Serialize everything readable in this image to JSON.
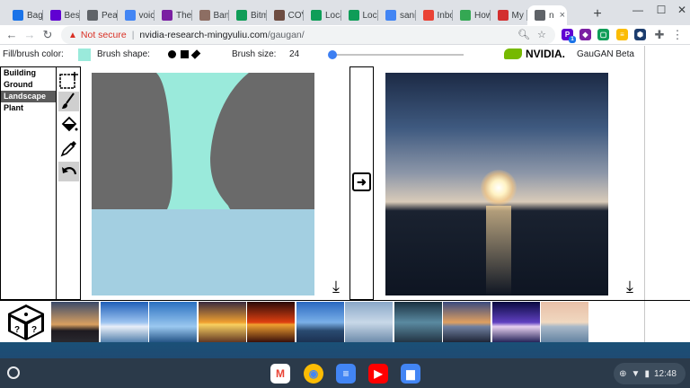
{
  "browser": {
    "tabs": [
      {
        "label": "Bagl",
        "favicon_color": "#1a73e8"
      },
      {
        "label": "Best",
        "favicon_color": "#6001d2"
      },
      {
        "label": "Peak",
        "favicon_color": "#5f6368"
      },
      {
        "label": "voice",
        "favicon_color": "#4285f4"
      },
      {
        "label": "The",
        "favicon_color": "#7b1fa2"
      },
      {
        "label": "Bang",
        "favicon_color": "#8d6e63"
      },
      {
        "label": "Bitm",
        "favicon_color": "#0f9d58"
      },
      {
        "label": "COV",
        "favicon_color": "#6d4c41"
      },
      {
        "label": "Loca",
        "favicon_color": "#0f9d58"
      },
      {
        "label": "Loca",
        "favicon_color": "#0f9d58"
      },
      {
        "label": "sanit",
        "favicon_color": "#4285f4"
      },
      {
        "label": "Inbo",
        "favicon_color": "#ea4335"
      },
      {
        "label": "How",
        "favicon_color": "#34a853"
      },
      {
        "label": "My L",
        "favicon_color": "#d32f2f"
      },
      {
        "label": "n",
        "favicon_color": "#5f6368"
      }
    ],
    "new_tab": "+",
    "window_controls": {
      "minimize": "—",
      "maximize": "☐",
      "close": "✕"
    },
    "security_label": "Not secure",
    "url_host": "nvidia-research-mingyuliu.com",
    "url_path": "/gaugan/",
    "extension_badge": "1"
  },
  "app": {
    "fill_label": "Fill/brush color:",
    "fill_color": "#9aeadb",
    "brush_shape_label": "Brush shape:",
    "brush_size_label": "Brush size:",
    "brush_size": "24",
    "brand": "NVIDIA.",
    "app_name": "GauGAN Beta",
    "categories": [
      "Building",
      "Ground",
      "Landscape",
      "Plant"
    ],
    "selected_category": "Landscape",
    "arrow": "➜",
    "canvas_colors": {
      "sky": "#9aeadb",
      "rock": "#6a6a6a",
      "water": "#a3cfe1"
    }
  },
  "shelf": {
    "time": "12:48",
    "apps": [
      {
        "name": "gmail",
        "color": "#ffffff",
        "glyph": "M"
      },
      {
        "name": "chrome",
        "color": "#ea4335",
        "glyph": "●"
      },
      {
        "name": "docs",
        "color": "#4285f4",
        "glyph": "≡"
      },
      {
        "name": "youtube",
        "color": "#ff0000",
        "glyph": "▶"
      },
      {
        "name": "files",
        "color": "#4285f4",
        "glyph": "▆"
      }
    ]
  }
}
